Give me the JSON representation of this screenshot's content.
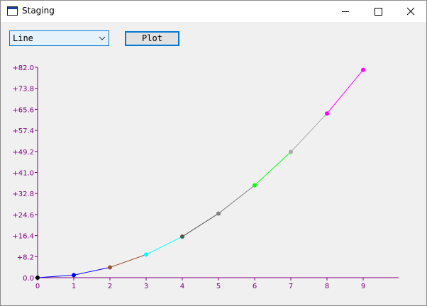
{
  "window": {
    "title": "Staging",
    "icon": "window-app-icon",
    "controls": [
      "minimize-icon",
      "maximize-icon",
      "close-icon"
    ]
  },
  "toolbar": {
    "chart_type_selected": "Line",
    "plot_button_label": "Plot"
  },
  "colors": {
    "axis": "#800080",
    "focus_border": "#0078d7"
  },
  "chart_data": {
    "type": "line",
    "x": [
      0,
      1,
      2,
      3,
      4,
      5,
      6,
      7,
      8,
      9
    ],
    "y": [
      0,
      1,
      4,
      9,
      16,
      25,
      36,
      49,
      64,
      81
    ],
    "point_colors": [
      "#000000",
      "#0000ff",
      "#a0522d",
      "#00ffff",
      "#555555",
      "#808080",
      "#00ff00",
      "#a9a9a9",
      "#ff00ff",
      "#ff00ff"
    ],
    "segment_colors": [
      "#0000ff",
      "#0000ff",
      "#a0522d",
      "#00ffff",
      "#555555",
      "#808080",
      "#00ff00",
      "#a9a9a9",
      "#ff00ff"
    ],
    "x_ticks": [
      "0",
      "1",
      "2",
      "3",
      "4",
      "5",
      "6",
      "7",
      "8",
      "9"
    ],
    "y_ticks": [
      "0.0",
      "+8.2",
      "+16.4",
      "+24.6",
      "+32.8",
      "+41.0",
      "+49.2",
      "+57.4",
      "+65.6",
      "+73.8",
      "+82.0"
    ],
    "ylim": [
      0,
      82
    ],
    "xlim": [
      0,
      10
    ],
    "grid": false
  }
}
